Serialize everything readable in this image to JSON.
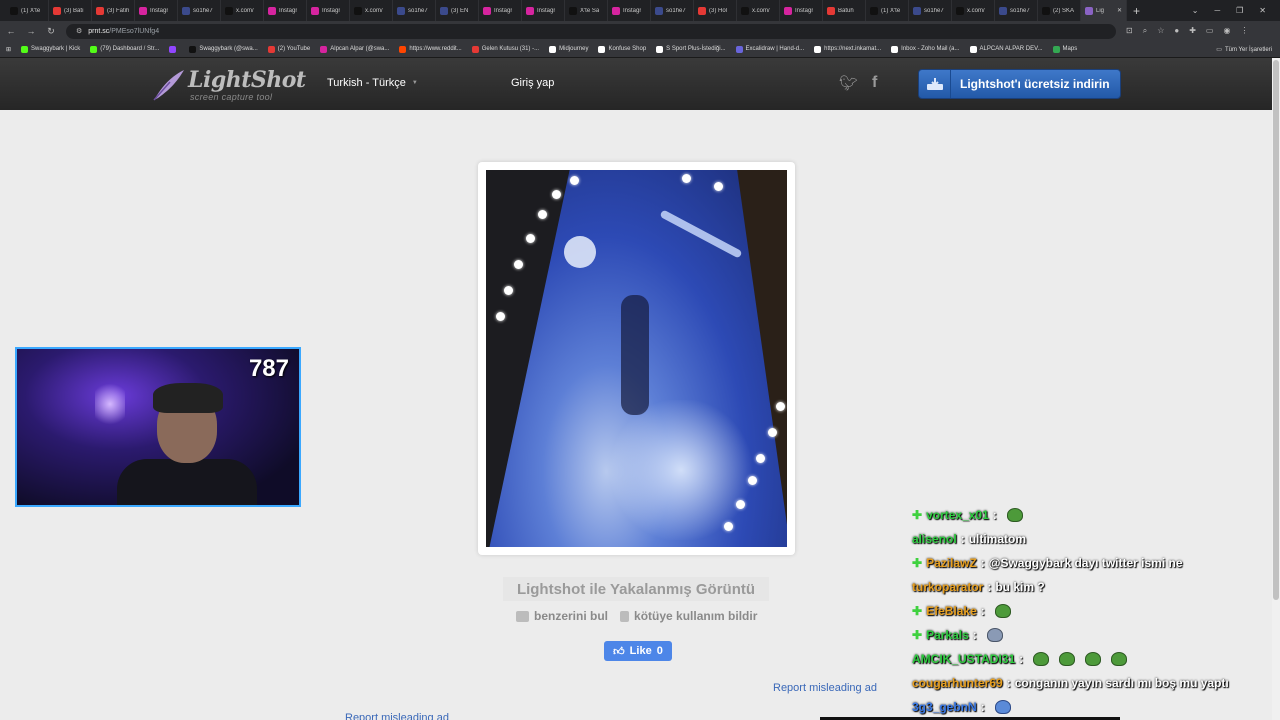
{
  "browser": {
    "tabs": [
      {
        "title": "(1) X'te",
        "color": "#111111"
      },
      {
        "title": "(3) Batı",
        "color": "#e53935"
      },
      {
        "title": "(3) Fatih",
        "color": "#e53935"
      },
      {
        "title": "Instagr",
        "color": "#d6249f"
      },
      {
        "title": "so1he7",
        "color": "#3b4a8c"
      },
      {
        "title": "x.com/",
        "color": "#111111"
      },
      {
        "title": "Instagr",
        "color": "#d6249f"
      },
      {
        "title": "Instagr",
        "color": "#d6249f"
      },
      {
        "title": "x.com/",
        "color": "#111111"
      },
      {
        "title": "so1he7",
        "color": "#3b4a8c"
      },
      {
        "title": "(3) EN",
        "color": "#3b4a8c"
      },
      {
        "title": "Instagr",
        "color": "#d6249f"
      },
      {
        "title": "Instagr",
        "color": "#d6249f"
      },
      {
        "title": "X'te Sa",
        "color": "#111111"
      },
      {
        "title": "Instagr",
        "color": "#d6249f"
      },
      {
        "title": "so1he7",
        "color": "#3b4a8c"
      },
      {
        "title": "(3) Hol",
        "color": "#e53935"
      },
      {
        "title": "x.com/",
        "color": "#111111"
      },
      {
        "title": "Instagr",
        "color": "#d6249f"
      },
      {
        "title": "Batuh",
        "color": "#e53935"
      },
      {
        "title": "(1) X'te",
        "color": "#111111"
      },
      {
        "title": "so1he7",
        "color": "#3b4a8c"
      },
      {
        "title": "x.com/",
        "color": "#111111"
      },
      {
        "title": "so1he7",
        "color": "#3b4a8c"
      },
      {
        "title": "(2) SKA",
        "color": "#111111"
      },
      {
        "title": "Lig",
        "color": "#8a63c4"
      }
    ],
    "new_tab": "+",
    "url_host": "prnt.sc",
    "url_path": "/PMEso7lUNfg4",
    "bookmarks": [
      {
        "label": "Swaggybark | Kick",
        "color": "#53fc18"
      },
      {
        "label": "(79) Dashboard / Str...",
        "color": "#53fc18"
      },
      {
        "label": "",
        "color": "#9146ff"
      },
      {
        "label": "Swaggybark (@swa...",
        "color": "#111111"
      },
      {
        "label": "(2) YouTube",
        "color": "#e53935"
      },
      {
        "label": "Alpcan Alpar (@swa...",
        "color": "#d6249f"
      },
      {
        "label": "https://www.reddit...",
        "color": "#ff4500"
      },
      {
        "label": "Gelen Kutusu (31) -...",
        "color": "#e53935"
      },
      {
        "label": "Midjourney",
        "color": "#ffffff"
      },
      {
        "label": "Konfuse Shop",
        "color": "#ffffff"
      },
      {
        "label": "S Sport Plus-İstediği...",
        "color": "#ffffff"
      },
      {
        "label": "Excalidraw | Hand-d...",
        "color": "#6965db"
      },
      {
        "label": "https://next.inkamat...",
        "color": "#ffffff"
      },
      {
        "label": "Inbox - Zoho Mail (a...",
        "color": "#ffffff"
      },
      {
        "label": "ALPCAN ALPAR DEV...",
        "color": "#ffffff"
      },
      {
        "label": "Maps",
        "color": "#34a853"
      }
    ],
    "all_bookmarks": "Tüm Yer İşaretleri"
  },
  "header": {
    "logo_text": "LightShot",
    "logo_tagline": "screen capture tool",
    "language": "Turkish - Türkçe",
    "login": "Giriş yap",
    "download_button": "Lightshot'ı ücretsiz indirin"
  },
  "main": {
    "title": "Lightshot ile Yakalanmış Görüntü",
    "find_similar": "benzerini bul",
    "report_abuse": "kötüye kullanım bildir",
    "like_label": "Like",
    "like_count": "0",
    "report_ad": "Report misleading ad",
    "report_ad_2": "Report misleading ad"
  },
  "webcam": {
    "viewer_count": "787"
  },
  "chat": [
    {
      "badge": true,
      "user": "vortex_x01",
      "color": "#2ecc40",
      "text": "",
      "emote": "green"
    },
    {
      "badge": false,
      "user": "alisenol",
      "color": "#2ecc40",
      "text": "ultimatom",
      "emote": ""
    },
    {
      "badge": true,
      "user": "PazilawZ",
      "color": "#e8a020",
      "text": "@Swaggybark dayı twitter ismi ne",
      "emote": ""
    },
    {
      "badge": false,
      "user": "turkoparator",
      "color": "#e8a020",
      "text": "bu kim ?",
      "emote": ""
    },
    {
      "badge": true,
      "user": "EfeBlake",
      "color": "#e8a020",
      "text": "",
      "emote": "green"
    },
    {
      "badge": true,
      "user": "Parkals",
      "color": "#2ecc40",
      "text": "",
      "emote": "alt"
    },
    {
      "badge": false,
      "user": "AMCIK_USTADI31",
      "color": "#2ecc40",
      "text": "",
      "emote": "green4"
    },
    {
      "badge": false,
      "user": "cougarhunter69",
      "color": "#e8a020",
      "text": "conganın yayın sardı mı boş mu yaptı",
      "emote": ""
    },
    {
      "badge": false,
      "user": "3g3_gebnN",
      "color": "#3a7ae8",
      "text": "",
      "emote": "blue"
    }
  ]
}
